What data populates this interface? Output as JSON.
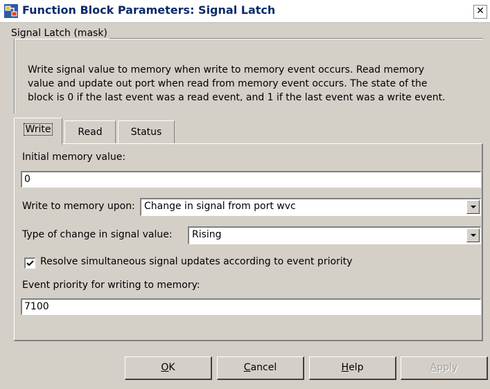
{
  "window": {
    "title": "Function Block Parameters: Signal Latch"
  },
  "group": {
    "legend": "Signal Latch (mask)",
    "description_lines": [
      "Write signal value to memory when write to memory event occurs. Read memory",
      "value and update out port when read from memory event occurs. The state of the",
      "block is 0 if the last event was a read event, and 1 if the last event was a write event."
    ]
  },
  "tabs": [
    {
      "label": "Write",
      "active": true
    },
    {
      "label": "Read",
      "active": false
    },
    {
      "label": "Status",
      "active": false
    }
  ],
  "form": {
    "initial_memory_label": "Initial memory value:",
    "initial_memory_value": "0",
    "write_upon_label": "Write to memory upon:",
    "write_upon_value": "Change in signal from port wvc",
    "change_type_label": "Type of change in signal value:",
    "change_type_value": "Rising",
    "resolve_checked": true,
    "resolve_label": "Resolve simultaneous signal updates according to event priority",
    "priority_label": "Event priority for writing to memory:",
    "priority_value": "7100"
  },
  "buttons": {
    "ok": {
      "mnemonic": "O",
      "rest": "K"
    },
    "cancel": {
      "mnemonic": "C",
      "rest": "ancel"
    },
    "help": {
      "mnemonic": "H",
      "rest": "elp"
    },
    "apply": {
      "mnemonic": "A",
      "rest": "pply",
      "enabled": false
    }
  },
  "icons": {
    "app": "simulink-block-icon",
    "close": "close-icon",
    "dropdown": "chevron-down-icon",
    "check": "checkmark-icon"
  },
  "colors": {
    "dialog_bg": "#d4d0c8",
    "title_text": "#0a2a6b",
    "field_bg": "#ffffff"
  }
}
